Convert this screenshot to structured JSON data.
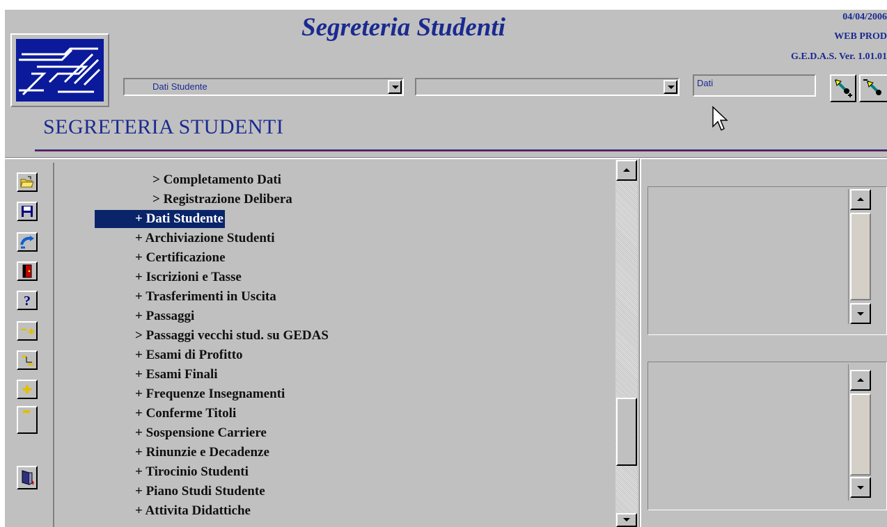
{
  "header": {
    "title": "Segreteria Studenti",
    "date": "04/04/2006",
    "environment": "WEB PROD",
    "version": "G.E.D.A.S. Ver. 1.01.01"
  },
  "toolbar_top": {
    "module_select": {
      "value": "Dati Studente"
    },
    "sub_select": {
      "value": ""
    },
    "search_field": {
      "value": "Dati"
    },
    "buttons": [
      {
        "icon": "find-next-icon"
      },
      {
        "icon": "find-previous-icon"
      }
    ]
  },
  "section": {
    "title": "SEGRETERIA STUDENTI"
  },
  "side_toolbar": {
    "buttons": [
      {
        "icon": "open-folder-icon"
      },
      {
        "icon": "save-disk-icon"
      },
      {
        "icon": "refresh-icon"
      },
      {
        "icon": "exit-door-icon"
      },
      {
        "icon": "help-question-icon"
      },
      {
        "icon": "expand-all-icon"
      },
      {
        "icon": "collapse-all-icon"
      },
      {
        "icon": "expand-plus-icon"
      },
      {
        "icon": "collapse-minus-icon"
      },
      {
        "icon": "logout-door-icon"
      }
    ]
  },
  "tree": {
    "items": [
      {
        "label": "> Completamento Dati",
        "level": 2,
        "selected": false
      },
      {
        "label": "> Registrazione Delibera",
        "level": 2,
        "selected": false
      },
      {
        "label": "+ Dati Studente",
        "level": 1,
        "selected": true
      },
      {
        "label": "+ Archiviazione Studenti",
        "level": 1,
        "selected": false
      },
      {
        "label": "+ Certificazione",
        "level": 1,
        "selected": false
      },
      {
        "label": "+ Iscrizioni e Tasse",
        "level": 1,
        "selected": false
      },
      {
        "label": "+ Trasferimenti in Uscita",
        "level": 1,
        "selected": false
      },
      {
        "label": "+ Passaggi",
        "level": 1,
        "selected": false
      },
      {
        "label": "> Passaggi vecchi stud. su GEDAS",
        "level": 1,
        "selected": false
      },
      {
        "label": "+ Esami di Profitto",
        "level": 1,
        "selected": false
      },
      {
        "label": "+ Esami Finali",
        "level": 1,
        "selected": false
      },
      {
        "label": "+ Frequenze Insegnamenti",
        "level": 1,
        "selected": false
      },
      {
        "label": "+ Conferme Titoli",
        "level": 1,
        "selected": false
      },
      {
        "label": "+ Sospensione Carriere",
        "level": 1,
        "selected": false
      },
      {
        "label": "+ Rinunzie e Decadenze",
        "level": 1,
        "selected": false
      },
      {
        "label": "+ Tirocinio Studenti",
        "level": 1,
        "selected": false
      },
      {
        "label": "+ Piano Studi Studente",
        "level": 1,
        "selected": false
      },
      {
        "label": "+ Attivita  Didattiche",
        "level": 1,
        "selected": false
      }
    ]
  },
  "colors": {
    "window_bg": "#c0c0c0",
    "accent_blue": "#1a2a90",
    "selection": "#0a246a"
  }
}
